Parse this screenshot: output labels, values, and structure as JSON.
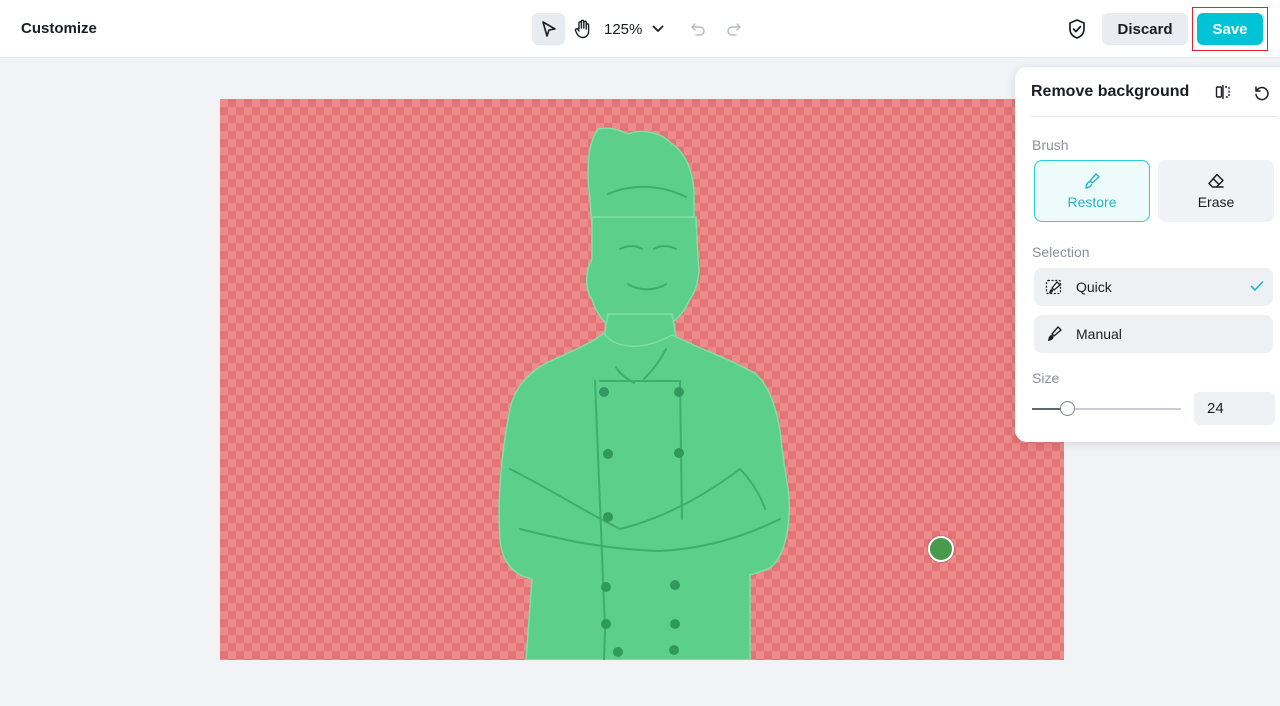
{
  "header": {
    "title": "Customize",
    "zoom": "125%",
    "discard_label": "Discard",
    "save_label": "Save"
  },
  "icons": {
    "select_tool": "cursor-arrow-icon",
    "pan_tool": "hand-icon",
    "zoom_dropdown": "chevron-down-icon",
    "undo": "undo-icon",
    "redo": "redo-icon",
    "protect": "shield-check-icon",
    "compare": "split-compare-icon",
    "reset": "reset-icon",
    "restore": "brush-icon",
    "erase": "eraser-icon",
    "quick": "magic-brush-icon",
    "manual": "brush-icon",
    "selected": "checkmark-icon"
  },
  "panel": {
    "title": "Remove background",
    "brush_label": "Brush",
    "brush_options": [
      {
        "label": "Restore",
        "active": true
      },
      {
        "label": "Erase",
        "active": false
      }
    ],
    "selection_label": "Selection",
    "selection_options": [
      {
        "label": "Quick",
        "selected": true
      },
      {
        "label": "Manual",
        "selected": false
      }
    ],
    "size_label": "Size",
    "size_value": "24",
    "size_fraction": 0.24
  },
  "colors": {
    "accent": "#00c4d6",
    "removed_overlay": "#ec8a8c",
    "kept_overlay": "#5ccf8a",
    "brush_cursor": "#4a9a4e",
    "highlight_box": "#e0242a"
  }
}
